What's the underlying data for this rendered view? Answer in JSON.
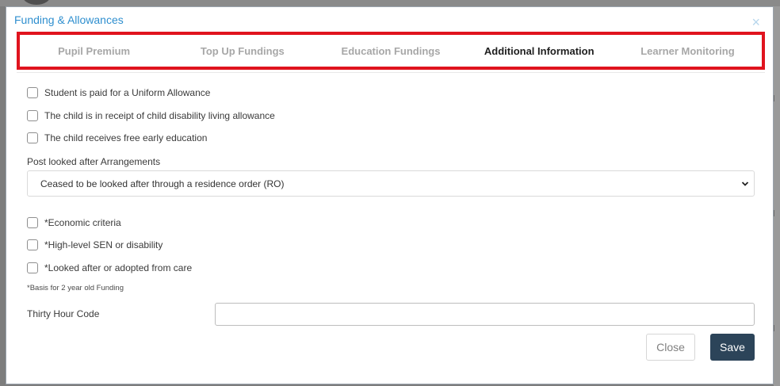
{
  "modal": {
    "title": "Funding & Allowances",
    "close_glyph": "×"
  },
  "tabs": [
    {
      "label": "Pupil Premium",
      "active": false
    },
    {
      "label": "Top Up Fundings",
      "active": false
    },
    {
      "label": "Education Fundings",
      "active": false
    },
    {
      "label": "Additional Information",
      "active": true
    },
    {
      "label": "Learner Monitoring",
      "active": false
    }
  ],
  "checkboxes_top": [
    {
      "label": "Student is paid for a Uniform Allowance",
      "checked": false
    },
    {
      "label": "The child is in receipt of child disability living allowance",
      "checked": false
    },
    {
      "label": "The child receives free early education",
      "checked": false
    }
  ],
  "post_looked_after": {
    "label": "Post looked after Arrangements",
    "selected": "Ceased to be looked after through a residence order (RO)"
  },
  "checkboxes_funding": [
    {
      "label": "*Economic criteria",
      "checked": false
    },
    {
      "label": "*High-level SEN or disability",
      "checked": false
    },
    {
      "label": "*Looked after or adopted from care",
      "checked": false
    }
  ],
  "footnote": "*Basis for 2 year old Funding",
  "thirty_hour_code": {
    "label": "Thirty Hour Code",
    "value": ""
  },
  "buttons": {
    "close": "Close",
    "save": "Save"
  },
  "colors": {
    "title_blue": "#2f8fcf",
    "highlight_red": "#e0141e",
    "save_navy": "#2c4459"
  },
  "icons": {
    "close": "close-icon",
    "select_chevron": "chevron-down-icon"
  }
}
